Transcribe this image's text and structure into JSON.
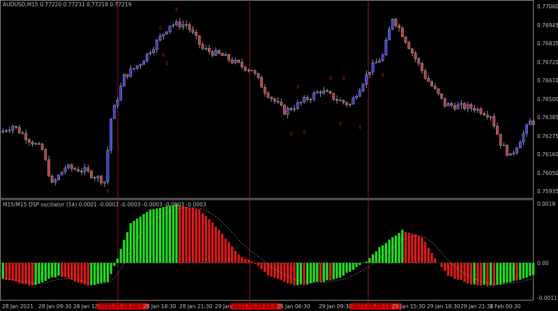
{
  "main": {
    "header": "AUDUSD,M15  0.77220 0.77231 0.77218 0.77219",
    "price_axis": [
      "0.77060",
      "0.76945",
      "0.76835",
      "0.76720",
      "0.76610",
      "0.76500",
      "0.76385",
      "0.76275",
      "0.76160",
      "0.76050",
      "0.75935"
    ],
    "price_path": [
      [
        0,
        0.76309
      ],
      [
        4,
        0.7635
      ],
      [
        9,
        0.76267
      ],
      [
        13,
        0.76205
      ],
      [
        16,
        0.75998
      ],
      [
        20,
        0.76101
      ],
      [
        26,
        0.76081
      ],
      [
        32,
        0.76018
      ],
      [
        34,
        0.76392
      ],
      [
        38,
        0.76641
      ],
      [
        43,
        0.76724
      ],
      [
        48,
        0.76848
      ],
      [
        52,
        0.76952
      ],
      [
        57,
        0.76952
      ],
      [
        62,
        0.76807
      ],
      [
        68,
        0.76765
      ],
      [
        74,
        0.76703
      ],
      [
        77,
        0.76682
      ],
      [
        81,
        0.76558
      ],
      [
        87,
        0.76433
      ],
      [
        91,
        0.76475
      ],
      [
        98,
        0.76558
      ],
      [
        104,
        0.76496
      ],
      [
        107,
        0.76475
      ],
      [
        113,
        0.76682
      ],
      [
        117,
        0.76765
      ],
      [
        120,
        0.76994
      ],
      [
        122,
        0.76931
      ],
      [
        126,
        0.76786
      ],
      [
        130,
        0.76641
      ],
      [
        136,
        0.76475
      ],
      [
        145,
        0.76454
      ],
      [
        150,
        0.76413
      ],
      [
        153,
        0.76247
      ],
      [
        156,
        0.76164
      ],
      [
        162,
        0.76371
      ]
    ],
    "colors": {
      "bull": "#3a3ad8",
      "bear": "#c03838",
      "separator": "#a01818",
      "fractal": "#c01818"
    }
  },
  "oscillator": {
    "header": "M15/M15 DSP oscillator (14) 0.0001 -0.0003 -0.0003 -0.0003 -0.0003 -0.0003",
    "axis": [
      "0.0018",
      "0.00",
      "-0.0011"
    ],
    "path": [
      [
        0,
        -0.00049
      ],
      [
        9,
        -0.0007
      ],
      [
        17,
        -0.00038
      ],
      [
        26,
        -0.0007
      ],
      [
        32,
        -0.00059
      ],
      [
        35,
        0.00015
      ],
      [
        39,
        0.00121
      ],
      [
        45,
        0.00163
      ],
      [
        53,
        0.00178
      ],
      [
        60,
        0.00163
      ],
      [
        66,
        0.001
      ],
      [
        72,
        0.00025
      ],
      [
        77,
        -2e-05
      ],
      [
        81,
        -0.00038
      ],
      [
        89,
        -0.0007
      ],
      [
        96,
        -0.00059
      ],
      [
        102,
        -0.00049
      ],
      [
        111,
        4e-05
      ],
      [
        115,
        0.00047
      ],
      [
        122,
        0.001
      ],
      [
        128,
        0.00078
      ],
      [
        132,
        0.00015
      ],
      [
        136,
        -0.00038
      ],
      [
        143,
        -0.00066
      ],
      [
        149,
        -0.0007
      ],
      [
        155,
        -0.00059
      ],
      [
        162,
        -0.00038
      ]
    ],
    "colors": {
      "up": "#22dd22",
      "down": "#dd1a1a"
    }
  },
  "time_axis": [
    {
      "label": "28 Jan 2021",
      "hl": false
    },
    {
      "label": "28 Jan 09:30",
      "hl": false
    },
    {
      "label": "28 Jan 12:30",
      "hl": false
    },
    {
      "label": "2021.01.28 16:15",
      "hl": true
    },
    {
      "label": "28 Jan 18:30",
      "hl": false
    },
    {
      "label": "28 Jan 21:30",
      "hl": false
    },
    {
      "label": "29 Jan 03:30",
      "hl": false
    },
    {
      "label": "2021.01.29 03:30",
      "hl": true
    },
    {
      "label": "29 Jan 06:30",
      "hl": false
    },
    {
      "label": "29 Jan 09:30",
      "hl": false
    },
    {
      "label": "2021.01.29 13:30",
      "hl": true
    },
    {
      "label": "29 Jan 15:30",
      "hl": false
    },
    {
      "label": "29 Jan 18:30",
      "hl": false
    },
    {
      "label": "29 Jan 21:30",
      "hl": false
    },
    {
      "label": "1 Feb 00:30",
      "hl": false
    }
  ]
}
